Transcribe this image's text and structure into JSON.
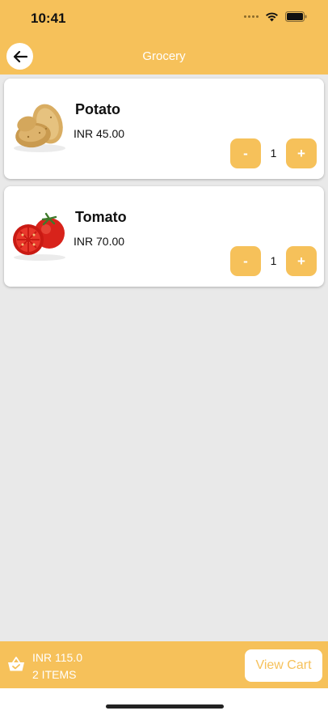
{
  "status_bar": {
    "time": "10:41"
  },
  "nav": {
    "title": "Grocery"
  },
  "products": [
    {
      "name": "Potato",
      "price": "INR 45.00",
      "qty": "1",
      "minus": "-",
      "plus": "+"
    },
    {
      "name": "Tomato",
      "price": "INR 70.00",
      "qty": "1",
      "minus": "-",
      "plus": "+"
    }
  ],
  "cart": {
    "total": "INR 115.0",
    "items": "2 ITEMS",
    "button": "View Cart"
  },
  "colors": {
    "accent": "#f6c15a",
    "background": "#e9e9e9",
    "card": "#ffffff"
  }
}
